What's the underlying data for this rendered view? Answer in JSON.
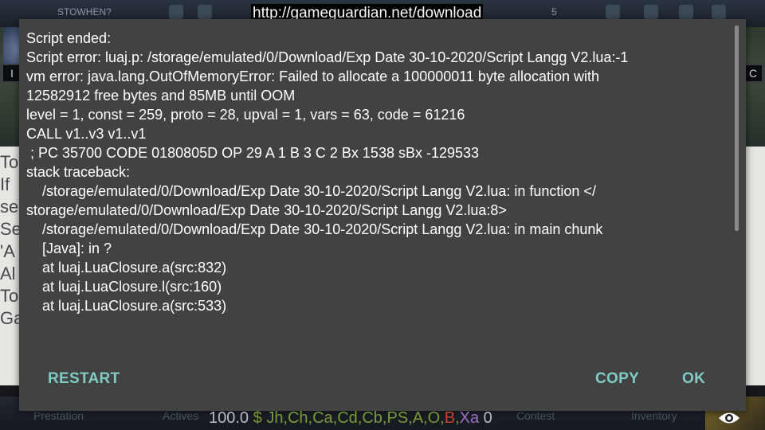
{
  "banner": {
    "url": "http://gameguardian.net/download"
  },
  "dialog": {
    "lines": [
      "Script ended:",
      "Script error: luaj.p: /storage/emulated/0/Download/Exp Date 30-10-2020/Script Langg V2.lua:-1",
      "",
      "vm error: java.lang.OutOfMemoryError: Failed to allocate a 100000011 byte allocation with",
      "12582912 free bytes and 85MB until OOM",
      "level = 1, const = 259, proto = 28, upval = 1, vars = 63, code = 61216",
      "CALL v1..v3 v1..v1",
      " ; PC 35700 CODE 0180805D OP 29 A 1 B 3 C 2 Bx 1538 sBx -129533",
      "stack traceback:",
      "    /storage/emulated/0/Download/Exp Date 30-10-2020/Script Langg V2.lua: in function </",
      "storage/emulated/0/Download/Exp Date 30-10-2020/Script Langg V2.lua:8>",
      "    /storage/emulated/0/Download/Exp Date 30-10-2020/Script Langg V2.lua: in main chunk",
      "    [Java]: in ?",
      "    at luaj.LuaClosure.a(src:832)",
      "    at luaj.LuaClosure.l(src:160)",
      "    at luaj.LuaClosure.a(src:533)"
    ],
    "buttons": {
      "restart": "RESTART",
      "copy": "COPY",
      "ok": "OK"
    }
  },
  "ticker": {
    "value": "100.0",
    "dollar": "$",
    "green_part": "Jh,Ch,Ca,Cd,Cb,PS,A,O,",
    "red_part": "B",
    "sep": ",",
    "purple_part": "Xa",
    "tail": " 0"
  },
  "background": {
    "topbar_label": "STOWHEN?",
    "topbar_count": "5",
    "left_chip": "I",
    "right_chip": "C",
    "side_letters": [
      "To",
      "If",
      "se",
      "Se",
      "'A",
      "Al",
      "To",
      "Ga"
    ],
    "tabs": [
      "Prestation",
      "Actives",
      "Contest",
      "Inventory"
    ]
  },
  "colors": {
    "dialog_bg": "#424242",
    "button_accent": "#80cbc4",
    "ticker_green": "#7a9a36",
    "ticker_red": "#c84232",
    "ticker_purple": "#9d6ec8"
  }
}
